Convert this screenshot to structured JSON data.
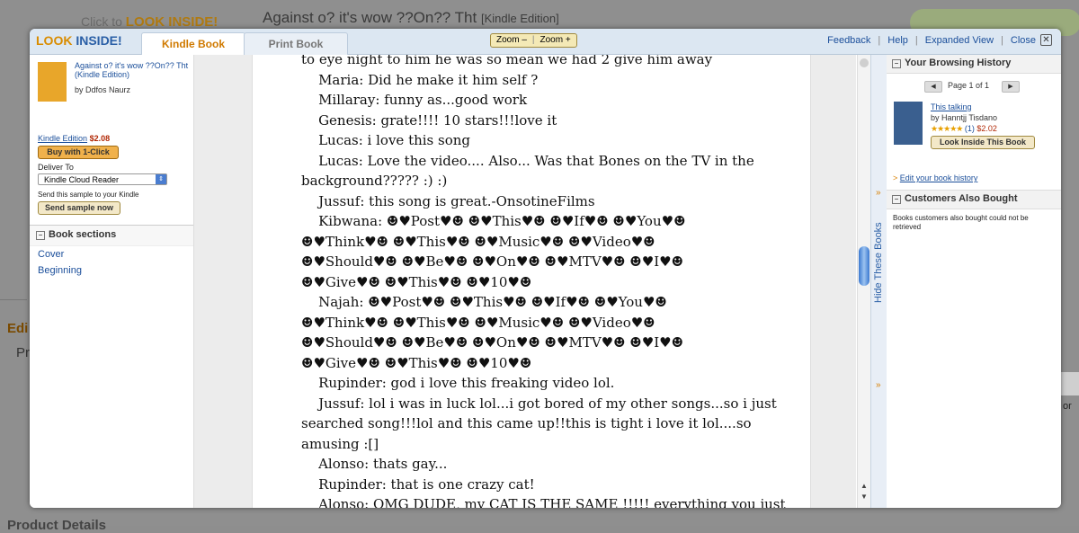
{
  "background": {
    "look_prefix": "Click to",
    "look_brand": "LOOK INSIDE!",
    "title": "Against o? it's wow ??On?? Tht",
    "edition": "[Kindle Edition]",
    "edi_heading": "Edi",
    "pr_text": "Pr",
    "product_details": "Product Details",
    "right_or": "or"
  },
  "topbar": {
    "logo_look": "LOOK",
    "logo_inside": "INSIDE!",
    "tabs": [
      {
        "label": "Kindle Book",
        "active": true
      },
      {
        "label": "Print Book",
        "active": false
      }
    ],
    "zoom_out": "Zoom –",
    "zoom_in": "Zoom +",
    "links": [
      "Feedback",
      "Help",
      "Expanded View",
      "Close"
    ],
    "close_glyph": "✕"
  },
  "left_panel": {
    "book_title": "Against o? it's wow ??On?? Tht (Kindle Edition)",
    "author": "by Ddfos Naurz",
    "format_label": "Kindle Edition",
    "price": "$2.08",
    "buy_button": "Buy with 1-Click",
    "deliver_label": "Deliver To",
    "deliver_value": "Kindle Cloud Reader",
    "send_label": "Send this sample to your Kindle",
    "send_button": "Send sample now",
    "sections_title": "Book sections",
    "sections": [
      "Cover",
      "Beginning"
    ],
    "collapse_glyph": "«"
  },
  "page_lines": [
    "to eye night to him he was so mean we had 2 give him away",
    "    Maria: Did he make it him self ?",
    "    Millaray: funny as...good work",
    "    Genesis: grate!!!! 10 stars!!!love it",
    "    Lucas: i love this song",
    "    Lucas: Love the video.... Also... Was that Bones on the TV in the",
    "background????? :) :)",
    "    Jussuf: this song is great.-OnsotineFilms",
    "    Kibwana: ☻♥Post♥☻ ☻♥This♥☻ ☻♥If♥☻ ☻♥You♥☻",
    "☻♥Think♥☻ ☻♥This♥☻ ☻♥Music♥☻ ☻♥Video♥☻",
    "☻♥Should♥☻ ☻♥Be♥☻ ☻♥On♥☻ ☻♥MTV♥☻ ☻♥I♥☻",
    "☻♥Give♥☻ ☻♥This♥☻ ☻♥10♥☻",
    "    Najah: ☻♥Post♥☻ ☻♥This♥☻ ☻♥If♥☻ ☻♥You♥☻",
    "☻♥Think♥☻ ☻♥This♥☻ ☻♥Music♥☻ ☻♥Video♥☻",
    "☻♥Should♥☻ ☻♥Be♥☻ ☻♥On♥☻ ☻♥MTV♥☻ ☻♥I♥☻",
    "☻♥Give♥☻ ☻♥This♥☻ ☻♥10♥☻",
    "    Rupinder: god i love this freaking video lol.",
    "    Jussuf: lol i was in luck lol...i got bored of my other songs...so i just",
    "searched song!!!lol and this came up!!this is tight i love it lol....so",
    "amusing :[]",
    "    Alonso: thats gay...",
    "    Rupinder: that is one crazy cat!",
    "    Alonso: OMG DUDE, my CAT IS THE SAME !!!!! everything you just"
  ],
  "scrollbar": {
    "up": "▲",
    "down": "▼"
  },
  "hide_strip": {
    "label": "Hide These Books",
    "chevron": "»"
  },
  "right_panel": {
    "history_title": "Your Browsing History",
    "pager_text": "Page 1 of 1",
    "pager_prev": "◀",
    "pager_next": "▶",
    "history_book": {
      "title": "This talking",
      "author": "by Hanntjj Tisdano",
      "stars": "★★★★★",
      "review_count": "(1)",
      "price": "$2.02",
      "button": "Look Inside This Book"
    },
    "edit_chevron": ">",
    "edit_link": "Edit your book history",
    "customers_title": "Customers Also Bought",
    "customers_text": "Books customers also bought could not be retrieved"
  }
}
